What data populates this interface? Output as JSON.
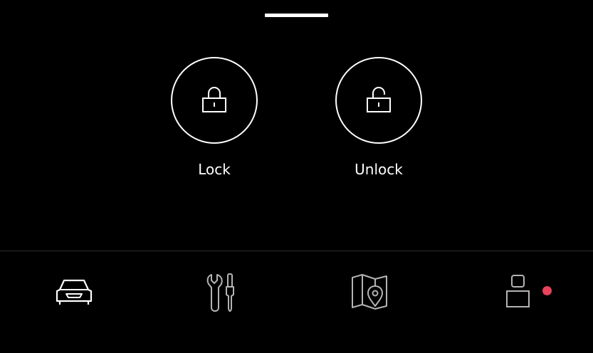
{
  "actions": {
    "lock": {
      "label": "Lock",
      "icon": "lock-closed-icon"
    },
    "unlock": {
      "label": "Unlock",
      "icon": "lock-open-icon"
    }
  },
  "nav": {
    "items": [
      {
        "id": "car",
        "icon": "car-icon",
        "active": true
      },
      {
        "id": "service",
        "icon": "wrench-screwdriver-icon",
        "active": false
      },
      {
        "id": "map",
        "icon": "map-pin-icon",
        "active": false
      },
      {
        "id": "profile",
        "icon": "user-icon",
        "active": false,
        "notification": true
      }
    ]
  },
  "colors": {
    "background": "#000000",
    "foreground": "#ffffff",
    "inactive_icon": "#b4b4b4",
    "notification": "#e8435a"
  }
}
